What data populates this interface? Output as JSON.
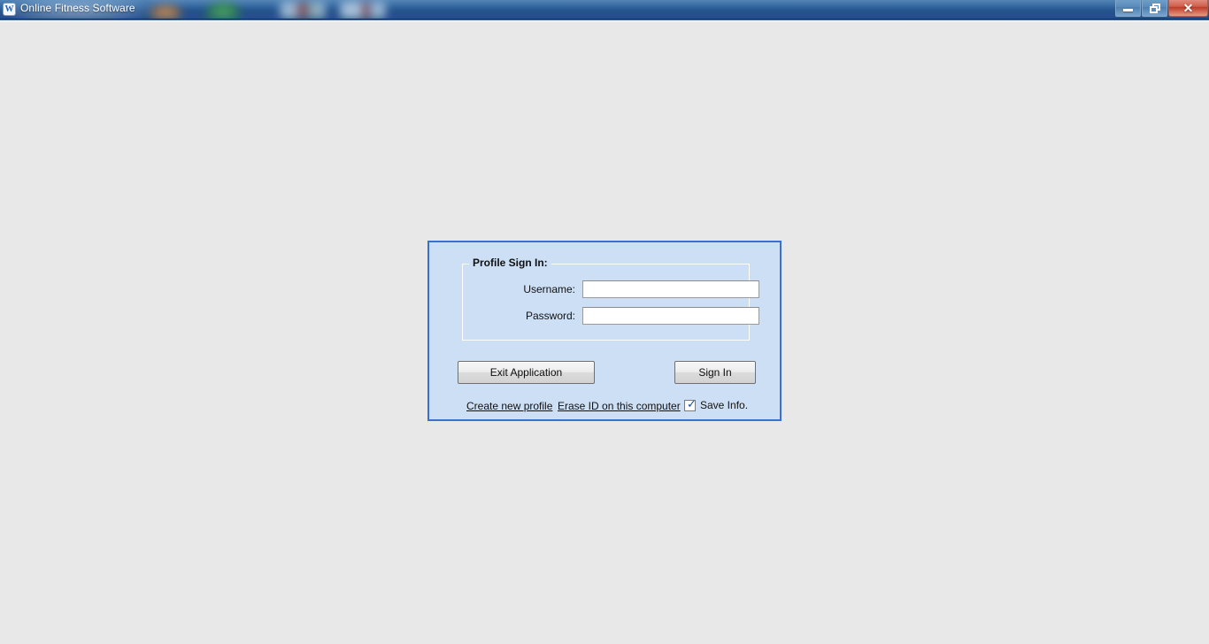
{
  "window": {
    "title": "Online Fitness Software",
    "app_icon": "W",
    "icon_name": "app-logo-icon",
    "background_color": "#e8e8e8",
    "titlebar_color": "#2a5a96",
    "controls": {
      "minimize_label": "—",
      "maximize_label": "❐",
      "close_label": "✕",
      "minimize_name": "minimize-button",
      "maximize_name": "restore-button",
      "close_name": "close-button"
    }
  },
  "login_panel": {
    "accent_color": "#3b6fd4",
    "panel_color": "#cddff5",
    "groupbox": {
      "legend": "Profile Sign In:",
      "fields": [
        {
          "label": "Username:",
          "value": "",
          "placeholder": ""
        },
        {
          "label": "Password:",
          "value": "",
          "placeholder": ""
        }
      ]
    },
    "buttons": {
      "exit_label": "Exit Application",
      "signin_label": "Sign In"
    },
    "links": [
      {
        "label": "Create new profile"
      },
      {
        "label": "Erase ID on this computer"
      }
    ],
    "save_info": {
      "label": "Save Info.",
      "checked": true,
      "check_glyph": "✓"
    }
  }
}
